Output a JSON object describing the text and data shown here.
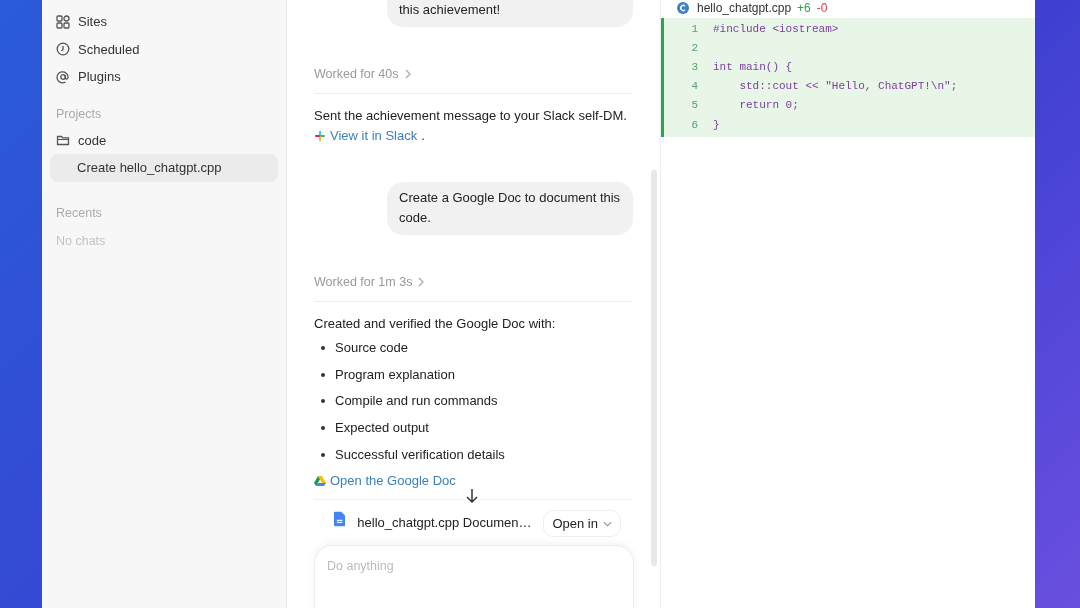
{
  "sidebar": {
    "nav": [
      {
        "label": "Sites"
      },
      {
        "label": "Scheduled"
      },
      {
        "label": "Plugins"
      }
    ],
    "projects_heading": "Projects",
    "projects": [
      {
        "label": "code",
        "selected": false
      },
      {
        "label": "Create hello_chatgpt.cpp",
        "selected": true
      }
    ],
    "recents_heading": "Recents",
    "recents_empty": "No chats"
  },
  "chat": {
    "messages": [
      {
        "kind": "user",
        "text": "this achievement!"
      },
      {
        "kind": "worked",
        "text": "Worked for 40s"
      },
      {
        "kind": "assistant",
        "text": "Sent the achievement message to your Slack self-DM.",
        "link": "View it in Slack",
        "after": "."
      },
      {
        "kind": "user",
        "text": "Create a Google Doc to document this code."
      },
      {
        "kind": "worked",
        "text": "Worked for 1m 3s"
      },
      {
        "kind": "assistant",
        "text": "Created and verified the Google Doc with:",
        "bullets": [
          "Source code",
          "Program explanation",
          "Compile and run commands",
          "Expected output",
          "Successful verification details"
        ],
        "link": "Open the Google Doc"
      }
    ],
    "attachment": {
      "title": "hello_chatgpt.cpp Documen…",
      "button": "Open in"
    },
    "composer": {
      "placeholder": "Do anything"
    }
  },
  "editor": {
    "file": "hello_chatgpt.cpp",
    "added": "+6",
    "removed": "-0",
    "lines": [
      {
        "n": "1",
        "text": "#include <iostream>"
      },
      {
        "n": "2"
      },
      {
        "n": "3",
        "text": "int main() {"
      },
      {
        "n": "4",
        "text": "    std::cout << \"Hello, ChatGPT!\\n\";"
      },
      {
        "n": "5",
        "text": "    return 0;"
      },
      {
        "n": "6",
        "text": "}"
      }
    ]
  }
}
